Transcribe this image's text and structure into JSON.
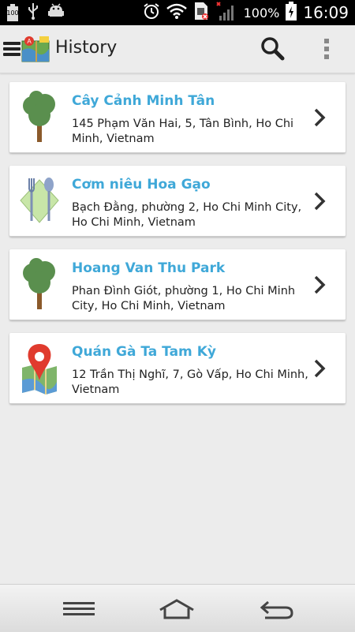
{
  "status_bar": {
    "icons": [
      "battery-100-icon",
      "usb-icon",
      "android-debug-icon",
      "alarm-icon",
      "wifi-icon",
      "sim-icon",
      "signal-icon",
      "battery-charging-icon"
    ],
    "battery_small_label": "100",
    "battery_percent": "100%",
    "time": "16:09"
  },
  "app_bar": {
    "title": "History",
    "icons": [
      "menu-icon",
      "app-logo-icon",
      "search-icon",
      "overflow-menu-icon"
    ]
  },
  "history": {
    "items": [
      {
        "title": "Cây Cảnh Minh Tân",
        "address": "145 Phạm Văn Hai, 5, Tân Bình, Ho Chi Minh, Vietnam",
        "icon": "tree-icon"
      },
      {
        "title": "Cơm niêu Hoa Gạo",
        "address": "Bạch Đằng, phường 2, Ho Chi Minh City, Ho Chi Minh, Vietnam",
        "icon": "restaurant-icon"
      },
      {
        "title": "Hoang Van Thu Park",
        "address": "Phan Đình Giót, phường 1, Ho Chi Minh City, Ho Chi Minh, Vietnam",
        "icon": "tree-icon"
      },
      {
        "title": "Quán Gà Ta Tam Kỳ",
        "address": "12 Trần Thị Nghĩ, 7, Gò Vấp, Ho Chi Minh, Vietnam",
        "icon": "map-pin-icon"
      }
    ]
  },
  "nav_bar": {
    "icons": [
      "recent-apps-icon",
      "home-icon",
      "back-icon"
    ]
  },
  "colors": {
    "title_accent": "#3fa8d8",
    "background": "#ececec",
    "card": "#ffffff"
  }
}
